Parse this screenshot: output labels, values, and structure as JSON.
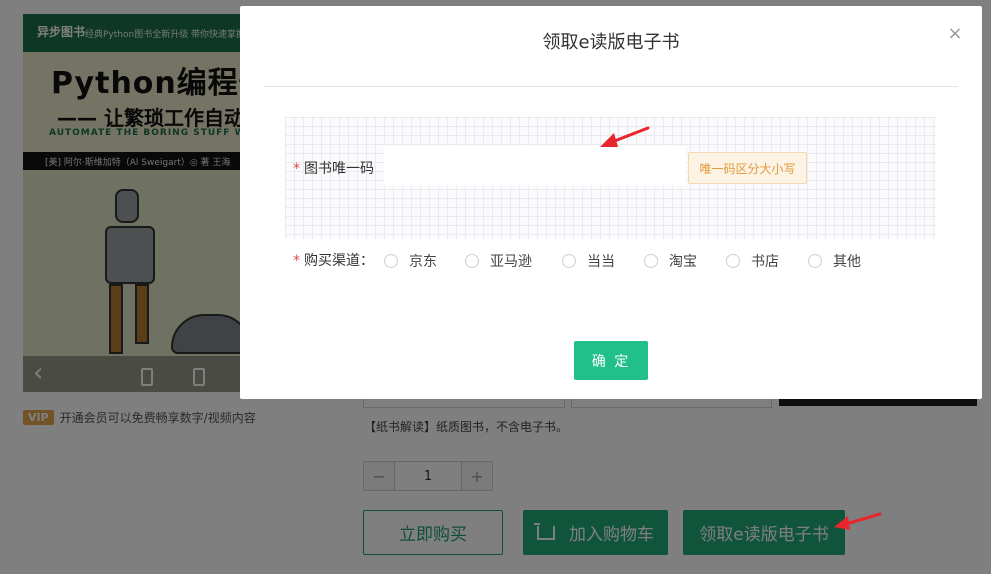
{
  "book": {
    "cover_logo": "异步图书",
    "cover_tagline": "经典Python图书全新升级  带你快速掌握高效工",
    "cover_title": "Python编程快速",
    "cover_subtitle": "—— 让繁琐工作自动化",
    "cover_english": "AUTOMATE THE BORING STUFF WITH PYT",
    "cover_author": "[美] 阿尔·斯维加特（Al Sweigart）◎ 著   王海"
  },
  "vip": {
    "badge": "VIP",
    "text": "开通会员可以免费畅享数字/视频内容"
  },
  "product": {
    "paper_note": "【纸书解读】纸质图书，不含电子书。",
    "quantity": "1",
    "minus": "−",
    "plus": "+",
    "buy_now": "立即购买",
    "add_cart": "加入购物车",
    "get_ebook": "领取e读版电子书"
  },
  "modal": {
    "title": "领取e读版电子书",
    "close": "×",
    "isbn_label": "图书唯一码",
    "required_mark": "*",
    "isbn_value": "",
    "isbn_placeholder": "",
    "case_hint": "唯一码区分大小写",
    "channel_label": "购买渠道：",
    "channels": [
      "京东",
      "亚马逊",
      "当当",
      "淘宝",
      "书店",
      "其他"
    ],
    "confirm": "确 定"
  },
  "colors": {
    "accent": "#21a979",
    "confirm": "#21c08b",
    "hint_text": "#e09a3a",
    "required": "#e04a4a",
    "annotation_arrow": "#e8272d"
  }
}
